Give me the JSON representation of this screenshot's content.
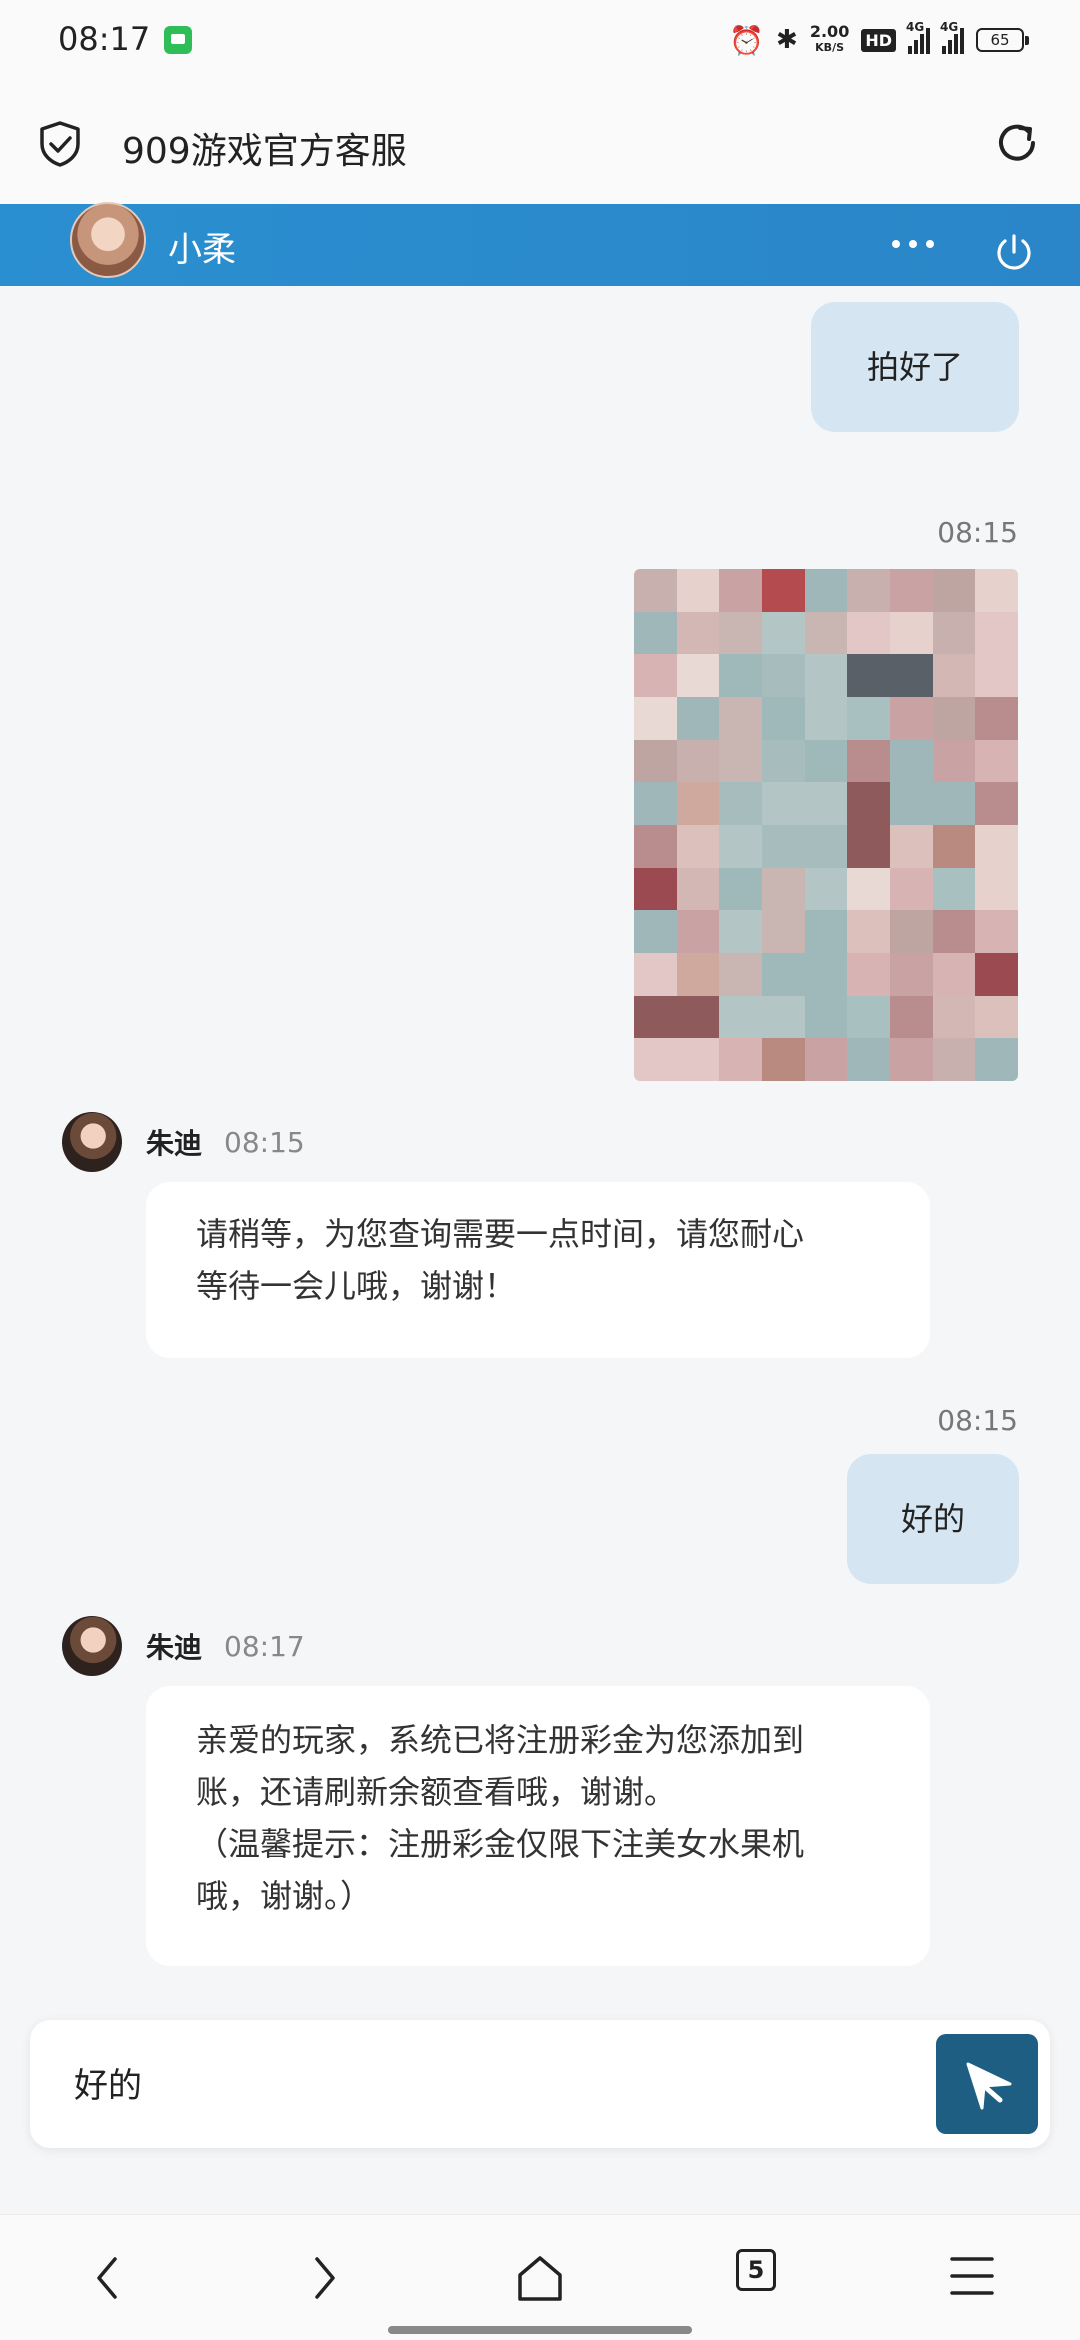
{
  "status_bar": {
    "time": "08:17",
    "net_speed_value": "2.00",
    "net_speed_unit": "KB/S",
    "hd_label": "HD",
    "signal1_label": "4G",
    "signal2_label": "4G",
    "battery": "65"
  },
  "browser": {
    "title": "909游戏官方客服"
  },
  "chat_header": {
    "agent_name": "小柔"
  },
  "messages": [
    {
      "id": "m1",
      "direction": "outgoing",
      "text": "拍好了"
    },
    {
      "id": "m2",
      "direction": "outgoing",
      "type": "image",
      "time": "08:15"
    },
    {
      "id": "m3",
      "direction": "incoming",
      "sender": "朱迪",
      "time": "08:15",
      "lines": [
        "请稍等，为您查询需要一点时间，请您耐心",
        "等待一会儿哦，谢谢！"
      ]
    },
    {
      "id": "m4",
      "direction": "outgoing",
      "text": "好的",
      "time": "08:15"
    },
    {
      "id": "m5",
      "direction": "incoming",
      "sender": "朱迪",
      "time": "08:17",
      "lines": [
        "亲爱的玩家，系统已将注册彩金为您添加到",
        "账，还请刷新余额查看哦，谢谢。",
        "（温馨提示：注册彩金仅限下注美女水果机",
        "哦，谢谢。）"
      ]
    }
  ],
  "composer": {
    "value": "好的"
  },
  "bottom_nav": {
    "tabs_count": "5"
  },
  "colors": {
    "header_blue": "#2a8fd0",
    "outgoing_bubble": "#d5e6f2",
    "send_button": "#1f5e83"
  }
}
